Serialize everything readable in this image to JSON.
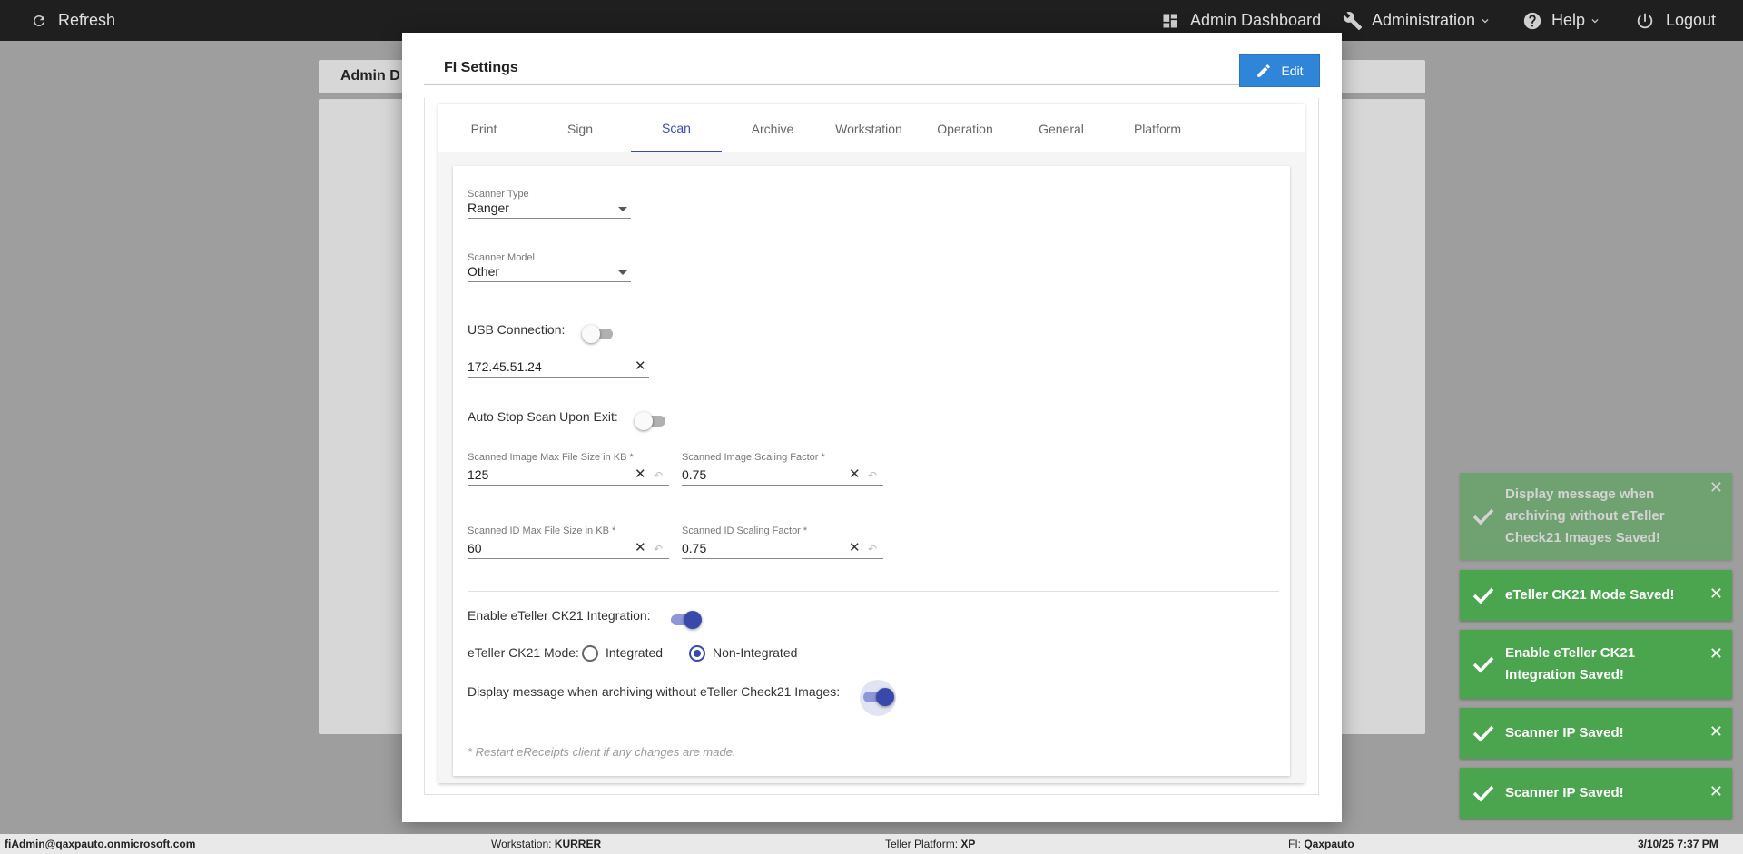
{
  "topbar": {
    "refresh_label": "Refresh",
    "admin_dashboard_label": "Admin Dashboard",
    "administration_label": "Administration",
    "help_label": "Help",
    "logout_label": "Logout"
  },
  "background_page": {
    "title": "Admin D"
  },
  "modal": {
    "title": "FI Settings",
    "edit_label": "Edit",
    "tabs": [
      "Print",
      "Sign",
      "Scan",
      "Archive",
      "Workstation",
      "Operation",
      "General",
      "Platform"
    ],
    "active_tab": "Scan"
  },
  "scan": {
    "scanner_type": {
      "label": "Scanner Type",
      "value": "Ranger"
    },
    "scanner_model": {
      "label": "Scanner Model",
      "value": "Other"
    },
    "usb_connection": {
      "label": "USB Connection:",
      "on": false
    },
    "scanner_ip": {
      "value": "172.45.51.24"
    },
    "auto_stop": {
      "label": "Auto Stop Scan Upon Exit:",
      "on": false
    },
    "image_max_size": {
      "label": "Scanned Image Max File Size in KB *",
      "value": "125"
    },
    "image_scaling": {
      "label": "Scanned Image Scaling Factor *",
      "value": "0.75"
    },
    "id_max_size": {
      "label": "Scanned ID Max File Size in KB *",
      "value": "60"
    },
    "id_scaling": {
      "label": "Scanned ID Scaling Factor *",
      "value": "0.75"
    },
    "enable_ck21": {
      "label": "Enable eTeller CK21 Integration:",
      "on": true
    },
    "ck21_mode": {
      "label": "eTeller CK21 Mode:",
      "options": [
        "Integrated",
        "Non-Integrated"
      ],
      "selected": "Non-Integrated"
    },
    "display_message": {
      "label": "Display message when archiving without eTeller Check21 Images:",
      "on": true
    },
    "note": "* Restart eReceipts client if any changes are made."
  },
  "toasts": [
    {
      "message": "Display message when archiving without eTeller Check21 Images Saved!",
      "faded": true
    },
    {
      "message": "eTeller CK21 Mode Saved!",
      "faded": false
    },
    {
      "message": "Enable eTeller CK21 Integration Saved!",
      "faded": false
    },
    {
      "message": "Scanner IP Saved!",
      "faded": false
    },
    {
      "message": "Scanner IP Saved!",
      "faded": false
    }
  ],
  "footer": {
    "user": "fiAdmin@qaxpauto.onmicrosoft.com",
    "workstation_label": "Workstation:",
    "workstation_value": "KURRER",
    "platform_label": "Teller Platform:",
    "platform_value": "XP",
    "fi_label": "FI:",
    "fi_value": "Qaxpauto",
    "datetime": "3/10/25 7:37 PM"
  },
  "colors": {
    "accent": "#3949ab",
    "edit_button": "#2f86d8",
    "toast_success": "#4aa54e",
    "topbar": "#1f1f1f"
  }
}
